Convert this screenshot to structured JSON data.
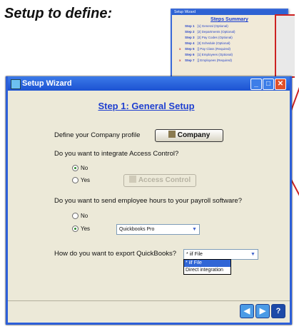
{
  "heading": "Setup to define:",
  "summary_thumb": {
    "title_bar": "Setup Wizard",
    "title": "Steps Summary",
    "lines": [
      {
        "mark": "",
        "step": "Step 1",
        "text": "[1] General (Optional)"
      },
      {
        "mark": "",
        "step": "Step 2",
        "text": "[2] Departments (Optional)"
      },
      {
        "mark": "",
        "step": "Step 3",
        "text": "[2] Pay Codes (Optional)"
      },
      {
        "mark": "",
        "step": "Step 4",
        "text": "[3] Schedule (Optional)"
      },
      {
        "mark": "x",
        "step": "Step 5",
        "text": "[] Pay Class (Required)"
      },
      {
        "mark": "",
        "step": "Step 6",
        "text": "[1] Employees (Optional)"
      },
      {
        "mark": "x",
        "step": "Step 7",
        "text": "[] Employees (Required)"
      }
    ]
  },
  "window": {
    "title": "Setup Wizard",
    "step_title": "Step 1: General Setup",
    "company_label": "Define your Company profile",
    "company_button": "Company",
    "access_label": "Do you want to integrate Access Control?",
    "access_no": "No",
    "access_yes": "Yes",
    "access_button": "Access Control",
    "payroll_label": "Do you want to send employee hours to your payroll software?",
    "payroll_no": "No",
    "payroll_yes": "Yes",
    "payroll_select": "Quickbooks Pro",
    "export_label": "How do you want to export QuickBooks?",
    "export_select": "* iif File",
    "export_options": [
      "* iif File",
      "Direct integration"
    ]
  }
}
